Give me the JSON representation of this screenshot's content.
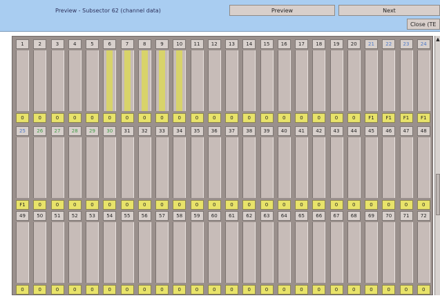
{
  "window": {
    "title": "Preview - Subsector 62 (channel data)",
    "preview_label": "Preview",
    "next_label": "Next",
    "close_label": "Close (TE"
  },
  "colors": {
    "blue_label": "#4d79c8",
    "green_label": "#3f9a45",
    "value_yellow": "#e8e36a"
  },
  "rows": [
    {
      "channels": [
        {
          "num": "1",
          "val": "0",
          "level": 0
        },
        {
          "num": "2",
          "val": "0",
          "level": 0
        },
        {
          "num": "3",
          "val": "0",
          "level": 0
        },
        {
          "num": "4",
          "val": "0",
          "level": 0
        },
        {
          "num": "5",
          "val": "0",
          "level": 0
        },
        {
          "num": "6",
          "val": "0",
          "level": 1
        },
        {
          "num": "7",
          "val": "0",
          "level": 1
        },
        {
          "num": "8",
          "val": "0",
          "level": 1
        },
        {
          "num": "9",
          "val": "0",
          "level": 1
        },
        {
          "num": "10",
          "val": "0",
          "level": 1
        },
        {
          "num": "11",
          "val": "0",
          "level": 0
        },
        {
          "num": "12",
          "val": "0",
          "level": 0
        },
        {
          "num": "13",
          "val": "0",
          "level": 0
        },
        {
          "num": "14",
          "val": "0",
          "level": 0
        },
        {
          "num": "15",
          "val": "0",
          "level": 0
        },
        {
          "num": "16",
          "val": "0",
          "level": 0
        },
        {
          "num": "17",
          "val": "0",
          "level": 0
        },
        {
          "num": "18",
          "val": "0",
          "level": 0
        },
        {
          "num": "19",
          "val": "0",
          "level": 0
        },
        {
          "num": "20",
          "val": "0",
          "level": 0
        },
        {
          "num": "21",
          "val": "F1",
          "level": 0,
          "color": "blue"
        },
        {
          "num": "22",
          "val": "F1",
          "level": 0,
          "color": "blue"
        },
        {
          "num": "23",
          "val": "F1",
          "level": 0,
          "color": "blue"
        },
        {
          "num": "24",
          "val": "F1",
          "level": 0,
          "color": "blue"
        }
      ]
    },
    {
      "channels": [
        {
          "num": "25",
          "val": "F1",
          "level": 0,
          "color": "blue"
        },
        {
          "num": "26",
          "val": "0",
          "level": 0,
          "color": "green"
        },
        {
          "num": "27",
          "val": "0",
          "level": 0,
          "color": "green"
        },
        {
          "num": "28",
          "val": "0",
          "level": 0,
          "color": "green"
        },
        {
          "num": "29",
          "val": "0",
          "level": 0,
          "color": "green"
        },
        {
          "num": "30",
          "val": "0",
          "level": 0,
          "color": "green"
        },
        {
          "num": "31",
          "val": "0",
          "level": 0
        },
        {
          "num": "32",
          "val": "0",
          "level": 0
        },
        {
          "num": "33",
          "val": "0",
          "level": 0
        },
        {
          "num": "34",
          "val": "0",
          "level": 0
        },
        {
          "num": "35",
          "val": "0",
          "level": 0
        },
        {
          "num": "36",
          "val": "0",
          "level": 0
        },
        {
          "num": "37",
          "val": "0",
          "level": 0
        },
        {
          "num": "38",
          "val": "0",
          "level": 0
        },
        {
          "num": "39",
          "val": "0",
          "level": 0
        },
        {
          "num": "40",
          "val": "0",
          "level": 0
        },
        {
          "num": "41",
          "val": "0",
          "level": 0
        },
        {
          "num": "42",
          "val": "0",
          "level": 0
        },
        {
          "num": "43",
          "val": "0",
          "level": 0
        },
        {
          "num": "44",
          "val": "0",
          "level": 0
        },
        {
          "num": "45",
          "val": "0",
          "level": 0
        },
        {
          "num": "46",
          "val": "0",
          "level": 0
        },
        {
          "num": "47",
          "val": "0",
          "level": 0
        },
        {
          "num": "48",
          "val": "0",
          "level": 0
        }
      ]
    },
    {
      "channels": [
        {
          "num": "49",
          "val": "0",
          "level": 0
        },
        {
          "num": "50",
          "val": "0",
          "level": 0
        },
        {
          "num": "51",
          "val": "0",
          "level": 0
        },
        {
          "num": "52",
          "val": "0",
          "level": 0
        },
        {
          "num": "53",
          "val": "0",
          "level": 0
        },
        {
          "num": "54",
          "val": "0",
          "level": 0
        },
        {
          "num": "55",
          "val": "0",
          "level": 0
        },
        {
          "num": "56",
          "val": "0",
          "level": 0
        },
        {
          "num": "57",
          "val": "0",
          "level": 0
        },
        {
          "num": "58",
          "val": "0",
          "level": 0
        },
        {
          "num": "59",
          "val": "0",
          "level": 0
        },
        {
          "num": "60",
          "val": "0",
          "level": 0
        },
        {
          "num": "61",
          "val": "0",
          "level": 0
        },
        {
          "num": "62",
          "val": "0",
          "level": 0
        },
        {
          "num": "63",
          "val": "0",
          "level": 0
        },
        {
          "num": "64",
          "val": "0",
          "level": 0
        },
        {
          "num": "65",
          "val": "0",
          "level": 0
        },
        {
          "num": "66",
          "val": "0",
          "level": 0
        },
        {
          "num": "67",
          "val": "0",
          "level": 0
        },
        {
          "num": "68",
          "val": "0",
          "level": 0
        },
        {
          "num": "69",
          "val": "0",
          "level": 0
        },
        {
          "num": "70",
          "val": "0",
          "level": 0
        },
        {
          "num": "71",
          "val": "0",
          "level": 0
        },
        {
          "num": "72",
          "val": "0",
          "level": 0
        }
      ]
    }
  ]
}
